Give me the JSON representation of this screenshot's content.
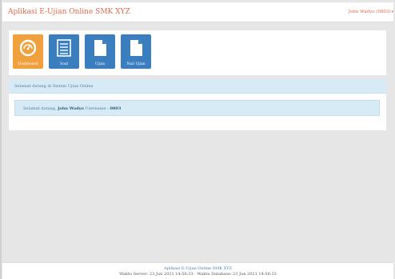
{
  "header": {
    "app_title": "Aplikasi E-Ujian Online SMK XYZ",
    "user_label": "John Wadyo (0803)"
  },
  "menu": {
    "tiles": [
      {
        "label": "Dashboard",
        "icon": "dashboard-gauge-icon",
        "color": "#f0a13d"
      },
      {
        "label": "Soal",
        "icon": "list-icon",
        "color": "#3b7ebf"
      },
      {
        "label": "Ujian",
        "icon": "document-icon",
        "color": "#3b7ebf"
      },
      {
        "label": "Nail Ujian",
        "icon": "document-icon",
        "color": "#3b7ebf"
      }
    ]
  },
  "welcome": {
    "heading": "Selamat datang di Sistem Ujian Online",
    "prefix": "Selamat datang,",
    "name": "John Wadyo",
    "username_label": "Username :",
    "username": "0803"
  },
  "footer": {
    "app_name": "Aplikasi E-Ujian Online SMK XYZ",
    "times": "Waktu Server: 23 Jun 2021 14:56:33 - Waktu Database: 23 Jun 2021 14:56:33"
  },
  "colors": {
    "accent": "#e06a4e",
    "tile_orange": "#f0a13d",
    "tile_blue": "#3b7ebf",
    "info_bg": "#d7ebf6"
  }
}
